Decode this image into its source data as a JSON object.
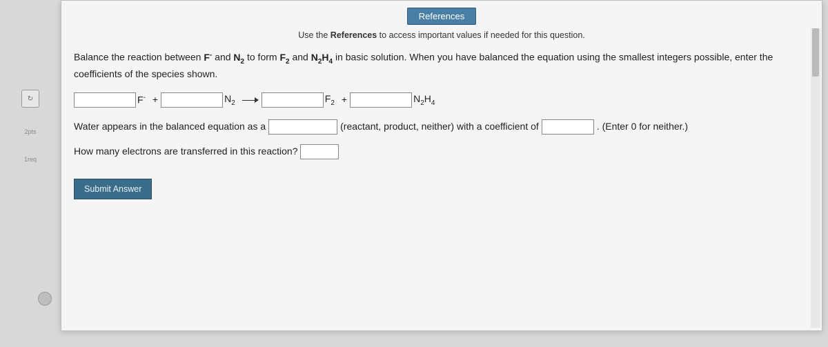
{
  "sidebar": {
    "items": [
      {
        "icon": "↻",
        "label": ""
      },
      {
        "icon": "☰",
        "label": "2pts"
      },
      {
        "icon": "",
        "label": "1req"
      }
    ]
  },
  "references": {
    "button": "References",
    "hint_prefix": "Use the ",
    "hint_bold": "References",
    "hint_suffix": " to access important values if needed for this question."
  },
  "question": {
    "prompt_part1": "Balance the reaction between ",
    "sp_Fminus": "F⁻",
    "prompt_part2": " and ",
    "sp_N2": "N₂",
    "prompt_part3": " to form ",
    "sp_F2": "F₂",
    "prompt_part4": " and ",
    "sp_N2H4": "N₂H₄",
    "prompt_part5": " in basic solution. When you have balanced the equation using the smallest integers possible, enter the coefficients of the species shown.",
    "eq": {
      "Fminus": "F⁻",
      "plus1": "+",
      "N2": "N₂",
      "F2": "F₂",
      "plus2": "+",
      "N2H4": "N₂H₄"
    },
    "water_line_1": "Water appears in the balanced equation as a",
    "water_line_2": "(reactant, product, neither) with a coefficient of",
    "water_line_3": ". (Enter 0 for neither.)",
    "electrons_line": "How many electrons are transferred in this reaction?",
    "submit": "Submit Answer"
  }
}
